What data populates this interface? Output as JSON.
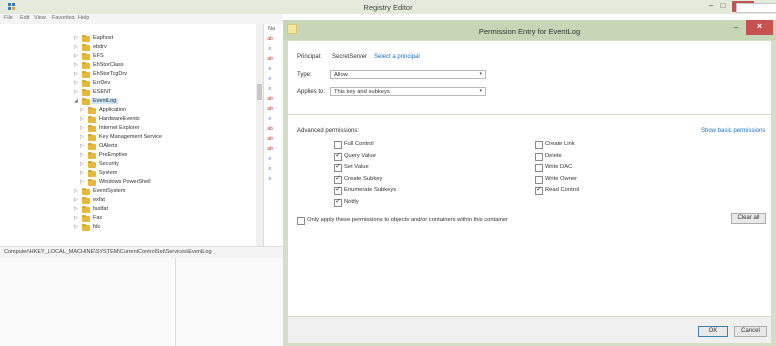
{
  "registry": {
    "title": "Registry Editor",
    "menu": [
      "File",
      "Edit",
      "View",
      "Favorites",
      "Help"
    ],
    "tree": [
      {
        "label": "Eaphost",
        "indent": 0,
        "expanded": false
      },
      {
        "label": "ebdrv",
        "indent": 0,
        "expanded": false
      },
      {
        "label": "EFS",
        "indent": 0,
        "expanded": false
      },
      {
        "label": "EhStorClass",
        "indent": 0,
        "expanded": false
      },
      {
        "label": "EhStorTcgDrv",
        "indent": 0,
        "expanded": false
      },
      {
        "label": "ErrDev",
        "indent": 0,
        "expanded": false
      },
      {
        "label": "ESENT",
        "indent": 0,
        "expanded": false
      },
      {
        "label": "EventLog",
        "indent": 0,
        "expanded": true
      },
      {
        "label": "Application",
        "indent": 1,
        "expanded": false
      },
      {
        "label": "HardwareEvents",
        "indent": 1,
        "expanded": false
      },
      {
        "label": "Internet Explorer",
        "indent": 1,
        "expanded": false
      },
      {
        "label": "Key Management Service",
        "indent": 1,
        "expanded": false
      },
      {
        "label": "OAlerts",
        "indent": 1,
        "expanded": false
      },
      {
        "label": "PreEmptive",
        "indent": 1,
        "expanded": false
      },
      {
        "label": "Security",
        "indent": 1,
        "expanded": false
      },
      {
        "label": "System",
        "indent": 1,
        "expanded": false
      },
      {
        "label": "Windows PowerShell",
        "indent": 1,
        "expanded": false
      },
      {
        "label": "EventSystem",
        "indent": 0,
        "expanded": false
      },
      {
        "label": "exfat",
        "indent": 0,
        "expanded": false
      },
      {
        "label": "fastfat",
        "indent": 0,
        "expanded": false
      },
      {
        "label": "Fax",
        "indent": 0,
        "expanded": false
      },
      {
        "label": "fdc",
        "indent": 0,
        "expanded": false
      }
    ],
    "value_header": "Na",
    "value_icons": [
      "ab",
      "bin",
      "ab",
      "bin",
      "bin",
      "bin",
      "ab",
      "ab",
      "bin",
      "ab",
      "ab",
      "ab",
      "bin",
      "bin",
      "bin"
    ],
    "status": "Computer\\HKEY_LOCAL_MACHINE\\SYSTEM\\CurrentControlSet\\Services\\EventLog"
  },
  "dialog": {
    "title": "Permission Entry for EventLog",
    "principal_label": "Principal:",
    "principal_value": "SecretServer",
    "select_principal_link": "Select a principal",
    "type_label": "Type:",
    "type_value": "Allow",
    "applies_label": "Applies to:",
    "applies_value": "This key and subkeys",
    "advanced_label": "Advanced permissions:",
    "show_basic_link": "Show basic permissions",
    "permissions_left": [
      {
        "label": "Full Control",
        "checked": false
      },
      {
        "label": "Query Value",
        "checked": true
      },
      {
        "label": "Set Value",
        "checked": true
      },
      {
        "label": "Create Subkey",
        "checked": true
      },
      {
        "label": "Enumerate Subkeys",
        "checked": true
      },
      {
        "label": "Notify",
        "checked": true
      }
    ],
    "permissions_right": [
      {
        "label": "Create Link",
        "checked": false
      },
      {
        "label": "Delete",
        "checked": false
      },
      {
        "label": "Write DAC",
        "checked": false
      },
      {
        "label": "Write Owner",
        "checked": false
      },
      {
        "label": "Read Control",
        "checked": true
      }
    ],
    "only_apply_label": "Only apply these permissions to objects and/or containers within this container",
    "only_apply_checked": false,
    "clear_all_label": "Clear all",
    "ok_label": "OK",
    "cancel_label": "Cancel"
  },
  "colors": {
    "dialog_frame": "#d2dfc4",
    "close_button": "#c75050",
    "link": "#1a6fc9",
    "folder": "#e8b838",
    "selection": "#cde6f7"
  }
}
